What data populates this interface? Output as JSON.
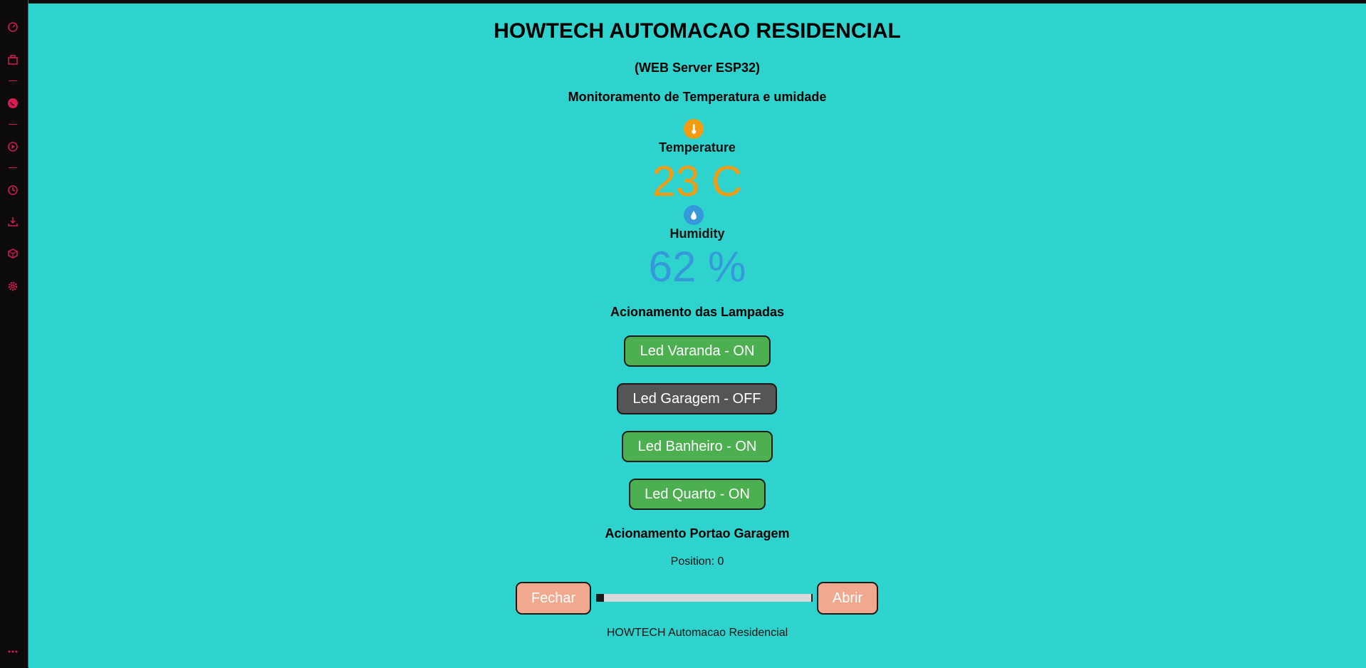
{
  "sidebar": {
    "icons": [
      "speedometer-icon",
      "briefcase-icon",
      "whatsapp-icon",
      "play-circle-icon",
      "clock-icon",
      "download-icon",
      "cube-icon",
      "gear-icon",
      "more-icon"
    ]
  },
  "page": {
    "title": "HOWTECH AUTOMACAO RESIDENCIAL",
    "subtitle": "(WEB Server ESP32)",
    "monitor_heading": "Monitoramento de Temperatura e umidade",
    "temperature": {
      "label": "Temperature",
      "value": "23 C",
      "color": "#f39c12"
    },
    "humidity": {
      "label": "Humidity",
      "value": "62 %",
      "color": "#3498db"
    },
    "lamps_heading": "Acionamento das Lampadas",
    "lamps": [
      {
        "label": "Led Varanda - ON",
        "state": "on"
      },
      {
        "label": "Led Garagem - OFF",
        "state": "off"
      },
      {
        "label": "Led Banheiro - ON",
        "state": "on"
      },
      {
        "label": "Led Quarto - ON",
        "state": "on"
      }
    ],
    "gate_heading": "Acionamento Portao Garagem",
    "position_text": "Position: 0",
    "position_value": 0,
    "close_label": "Fechar",
    "open_label": "Abrir",
    "footer": "HOWTECH Automacao Residencial"
  },
  "colors": {
    "background": "#2fd3ce",
    "sidebar_bg": "#0c0a0b",
    "sidebar_accent": "#d81b52",
    "button_on": "#4caf50",
    "button_off": "#555555",
    "door_button": "#f0a88f"
  }
}
